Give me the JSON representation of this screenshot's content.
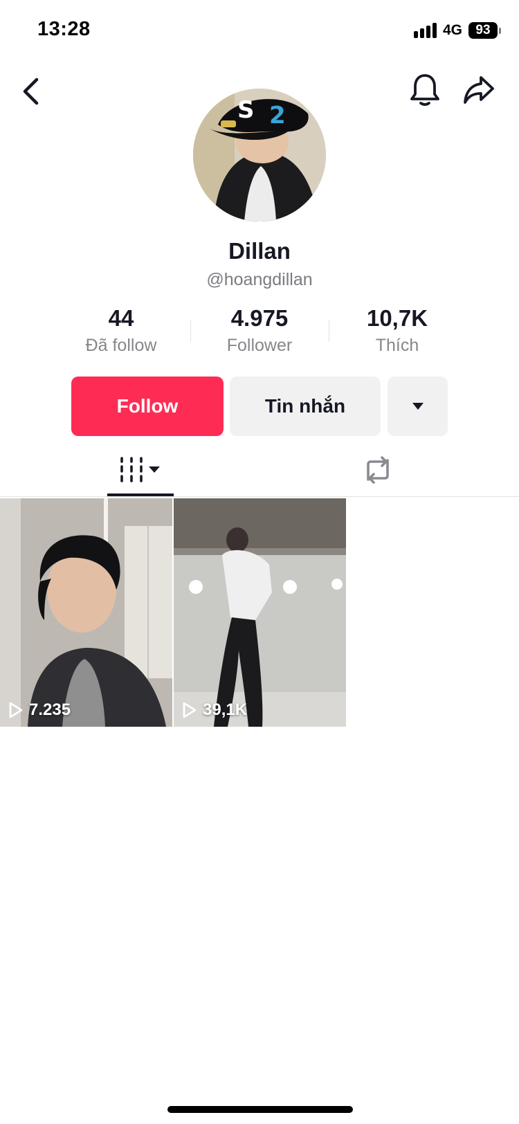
{
  "status_bar": {
    "time": "13:28",
    "network": "4G",
    "battery": "93"
  },
  "header": {
    "back_icon": "chevron-left-icon",
    "bell_icon": "bell-icon",
    "share_icon": "share-arrow-icon"
  },
  "profile": {
    "display_name": "Dillan",
    "username": "@hoangdillan"
  },
  "stats": {
    "following": {
      "value": "44",
      "label": "Đã follow"
    },
    "followers": {
      "value": "4.975",
      "label": "Follower"
    },
    "likes": {
      "value": "10,7K",
      "label": "Thích"
    }
  },
  "actions": {
    "follow_label": "Follow",
    "message_label": "Tin nhắn",
    "more_icon": "caret-down-icon"
  },
  "tabs": {
    "videos_icon": "grid-lines-icon",
    "reposts_icon": "repost-icon"
  },
  "videos": [
    {
      "views": "7.235"
    },
    {
      "views": "39,1K"
    }
  ],
  "colors": {
    "accent": "#fe2c55",
    "secondary_button": "#f1f1f2",
    "text_primary": "#161823",
    "text_secondary": "#86878b"
  }
}
